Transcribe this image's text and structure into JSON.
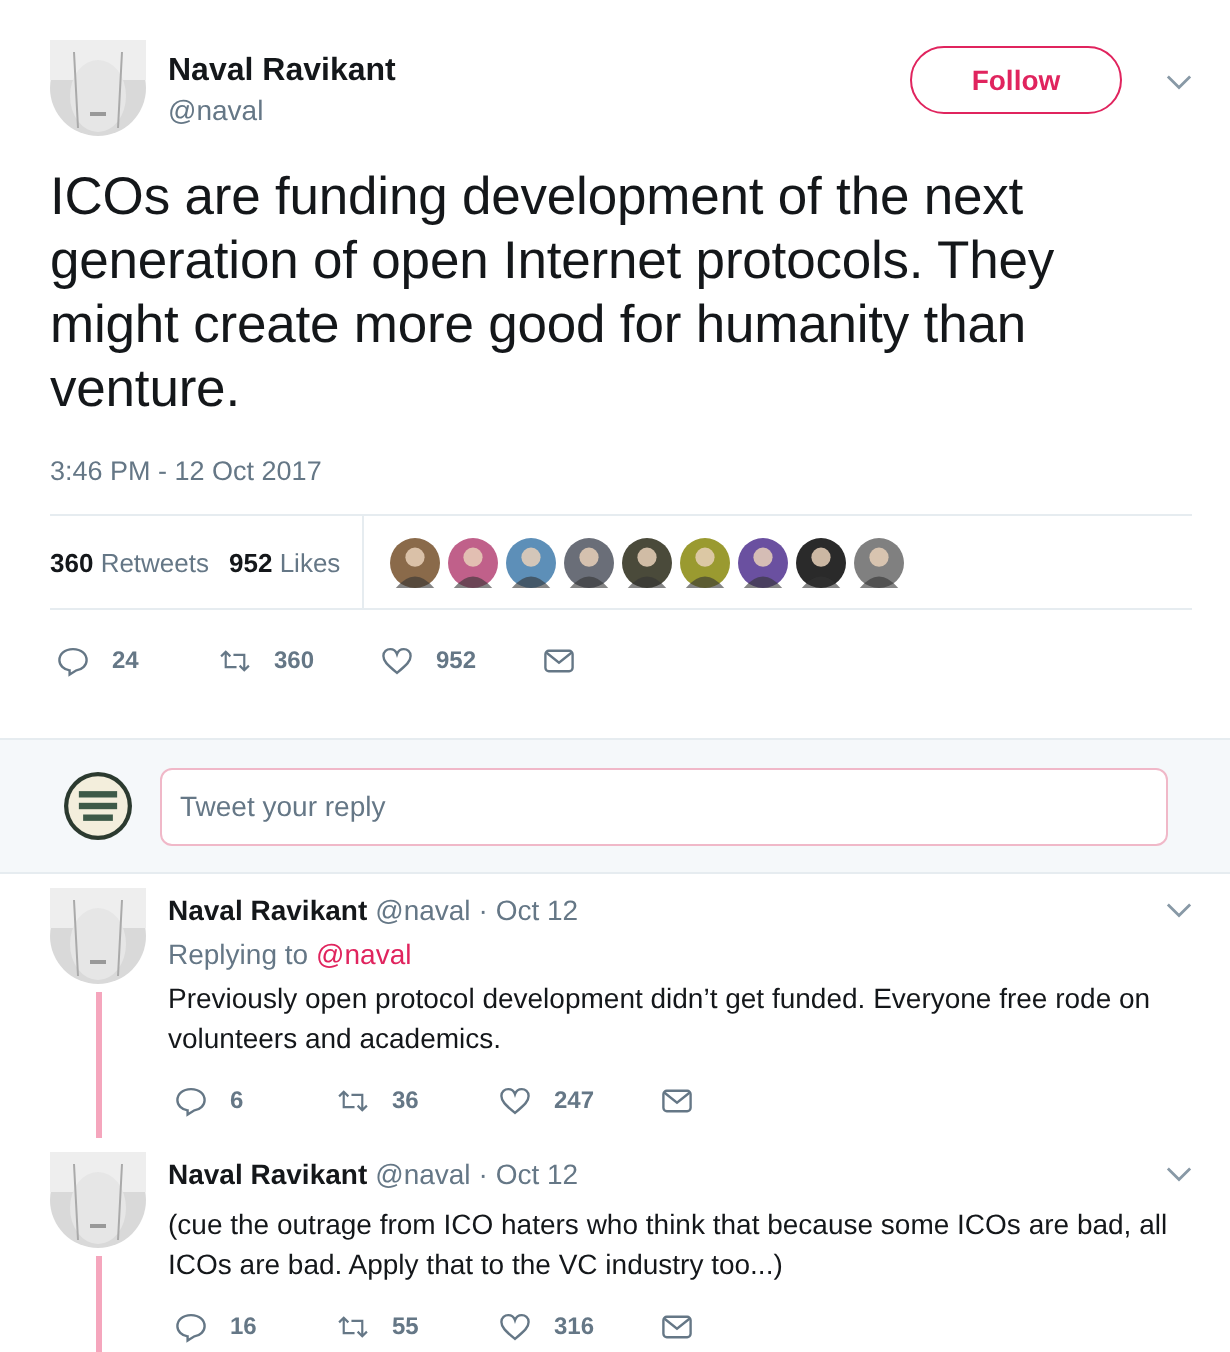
{
  "tweet": {
    "name": "Naval Ravikant",
    "handle": "@naval",
    "follow_label": "Follow",
    "text": "ICOs are funding development of the next generation of open Internet protocols. They might create more good for humanity than venture.",
    "time": "3:46 PM - 12 Oct 2017",
    "stats": [
      {
        "count": "360",
        "label": "Retweets"
      },
      {
        "count": "952",
        "label": "Likes"
      }
    ],
    "likers": [
      {
        "color": "#8a6a4a"
      },
      {
        "color": "#c0608a"
      },
      {
        "color": "#5d8fb8"
      },
      {
        "color": "#6a6e78"
      },
      {
        "color": "#4a4a3a"
      },
      {
        "color": "#9a9a30"
      },
      {
        "color": "#6a50a0"
      },
      {
        "color": "#2a2a2a"
      },
      {
        "color": "#808080"
      }
    ],
    "actions": {
      "replies": "24",
      "retweets": "360",
      "likes": "952"
    }
  },
  "reply_box": {
    "placeholder": "Tweet your reply"
  },
  "replies": [
    {
      "name": "Naval Ravikant",
      "handle": "@naval",
      "time": "· Oct 12",
      "replying_label": "Replying to",
      "replying_to": "@naval",
      "text": "Previously open protocol development didn’t get funded. Everyone free rode on volunteers and academics.",
      "actions": {
        "replies": "6",
        "retweets": "36",
        "likes": "247"
      }
    },
    {
      "name": "Naval Ravikant",
      "handle": "@naval",
      "time": "· Oct 12",
      "text": "(cue the outrage from ICO haters who think that because some ICOs are bad, all ICOs are bad. Apply that to the VC industry too...)",
      "actions": {
        "replies": "16",
        "retweets": "55",
        "likes": "316"
      }
    }
  ]
}
